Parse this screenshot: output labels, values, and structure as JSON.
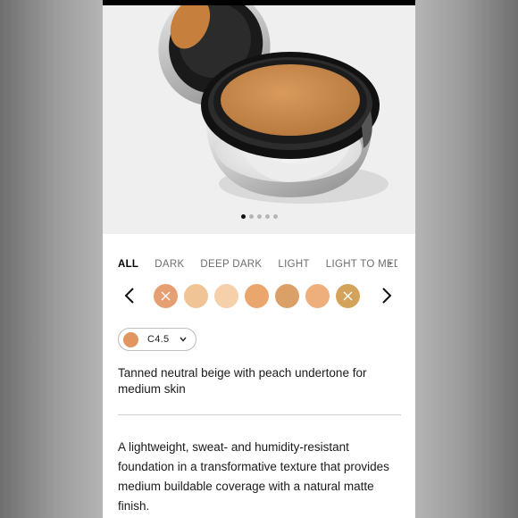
{
  "carousel": {
    "slide_count": 5,
    "active_slide": 1
  },
  "shade_tabs": [
    {
      "label": "ALL",
      "active": true
    },
    {
      "label": "DARK",
      "active": false
    },
    {
      "label": "DEEP DARK",
      "active": false
    },
    {
      "label": "LIGHT",
      "active": false
    },
    {
      "label": "LIGHT TO MEDIUM",
      "active": false
    }
  ],
  "swatches": [
    {
      "color": "#e59f73",
      "crossed": true
    },
    {
      "color": "#f0c494",
      "crossed": false
    },
    {
      "color": "#f6cfab",
      "crossed": false
    },
    {
      "color": "#eba66e",
      "crossed": false
    },
    {
      "color": "#dba068",
      "crossed": false
    },
    {
      "color": "#eeaf7c",
      "crossed": false
    },
    {
      "color": "#d3a35b",
      "crossed": true
    }
  ],
  "selected_shade": {
    "label": "C4.5",
    "color": "#e2965f"
  },
  "shade_description": "Tanned neutral beige with peach undertone for medium skin",
  "product_description": "A lightweight, sweat- and humidity-resistant foundation in a transformative texture that provides medium buildable coverage with a natural matte finish.",
  "icons": {
    "prev": "chevron-left-icon",
    "next": "chevron-right-icon",
    "dropdown": "chevron-down-icon"
  }
}
